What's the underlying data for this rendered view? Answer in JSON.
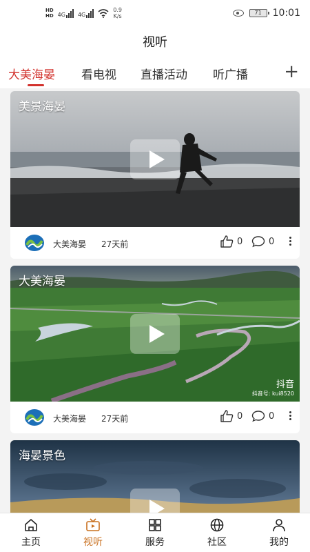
{
  "status_bar": {
    "hd_top": "HD",
    "hd_bottom": "HD",
    "net1": "4G",
    "net2": "4G",
    "speed_value": "0.9",
    "speed_unit": "K/s",
    "battery": "71",
    "time": "10:01"
  },
  "header": {
    "title": "视听"
  },
  "tabs": {
    "items": [
      {
        "label": "大美海晏"
      },
      {
        "label": "看电视"
      },
      {
        "label": "直播活动"
      },
      {
        "label": "听广播"
      }
    ],
    "active_index": 0,
    "add_label": "+"
  },
  "feed": {
    "cards": [
      {
        "title": "美景海晏",
        "author": "大美海晏",
        "time": "27天前",
        "likes": "0",
        "comments": "0"
      },
      {
        "title": "大美海晏",
        "author": "大美海晏",
        "time": "27天前",
        "likes": "0",
        "comments": "0",
        "watermark": "抖音",
        "watermark_id": "抖音号: kui8520"
      },
      {
        "title": "海晏景色"
      }
    ]
  },
  "bottom_nav": {
    "items": [
      {
        "label": "主页",
        "icon": "home-icon"
      },
      {
        "label": "视听",
        "icon": "tv-icon"
      },
      {
        "label": "服务",
        "icon": "grid-icon"
      },
      {
        "label": "社区",
        "icon": "globe-icon"
      },
      {
        "label": "我的",
        "icon": "user-icon"
      }
    ],
    "active_index": 1
  },
  "colors": {
    "accent_red": "#d2322d",
    "nav_active": "#c9701f"
  }
}
